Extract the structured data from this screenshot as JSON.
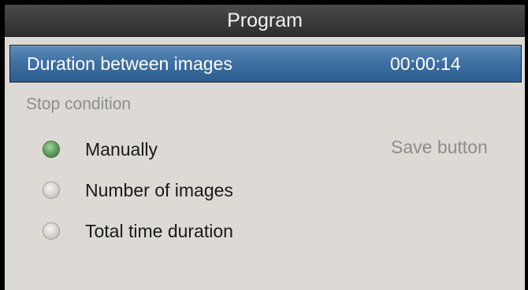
{
  "header": {
    "title": "Program"
  },
  "interval": {
    "label": "Duration between images",
    "value": "00:00:14"
  },
  "stop_condition": {
    "label": "Stop condition",
    "hint": "Save button",
    "options": [
      {
        "label": "Manually",
        "selected": true
      },
      {
        "label": "Number of images",
        "selected": false
      },
      {
        "label": "Total time duration",
        "selected": false
      }
    ]
  },
  "colors": {
    "titlebar": "#3a3a3a",
    "selection": "#3f71a3",
    "background": "#ddd9d5",
    "radio_selected": "#5a9a5a",
    "muted_text": "#8d8d8d"
  }
}
